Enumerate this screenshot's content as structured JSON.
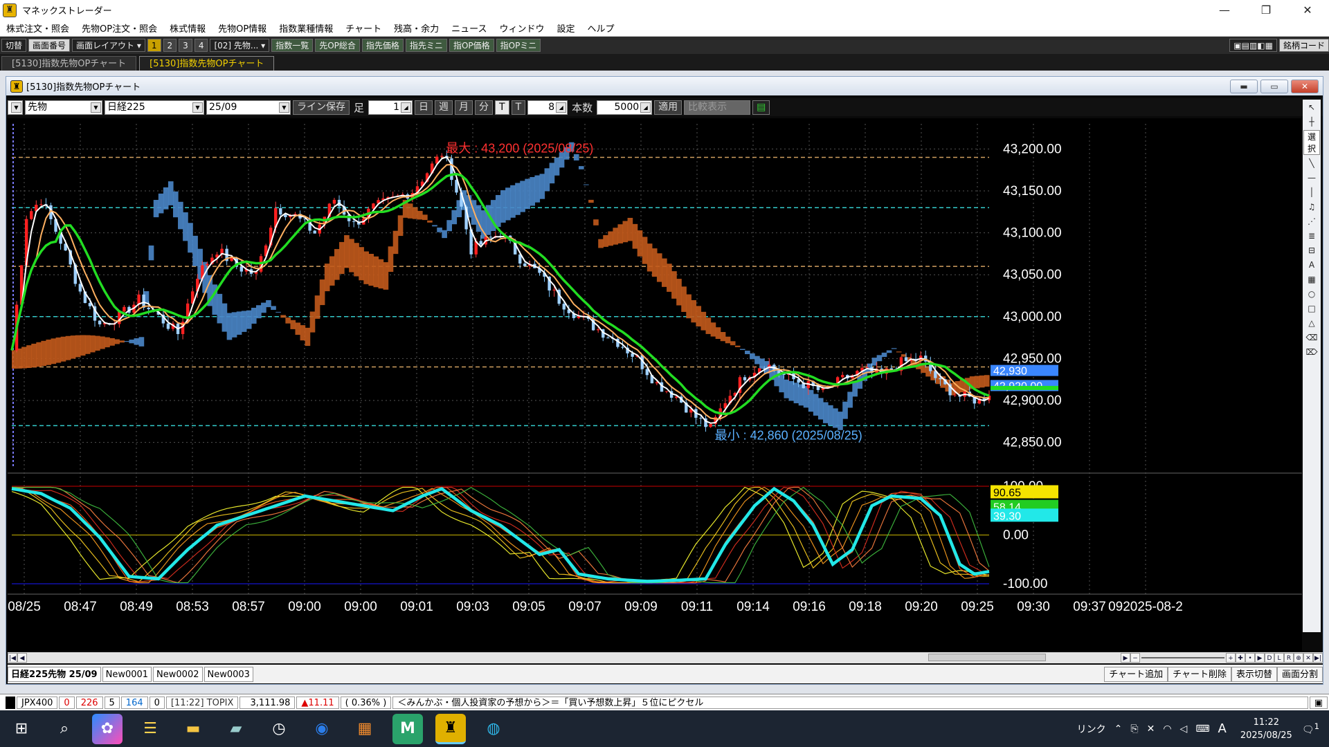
{
  "app": {
    "title": "マネックストレーダー"
  },
  "menu": [
    "株式注文・照会",
    "先物OP注文・照会",
    "株式情報",
    "先物OP情報",
    "指数業種情報",
    "チャート",
    "残高・余力",
    "ニュース",
    "ウィンドウ",
    "設定",
    "ヘルプ"
  ],
  "toolbar": {
    "switch": "切替",
    "screen_no": "画面番号",
    "layout": "画面レイアウト",
    "layouts": [
      "1",
      "2",
      "3",
      "4"
    ],
    "preset": "[02] 先物...",
    "buttons": [
      "指数一覧",
      "先OP総合",
      "指先価格",
      "指先ミニ",
      "指OP価格",
      "指OPミニ"
    ],
    "code_label": "銘柄コード"
  },
  "tabs": [
    "[5130]指数先物OPチャート",
    "[5130]指数先物OPチャート"
  ],
  "window": {
    "title": "[5130]指数先物OPチャート"
  },
  "controls": {
    "instrument": "先物",
    "index": "日経225",
    "contract": "25/09",
    "save_line": "ライン保存",
    "foot_label": "足",
    "foot_value": "1",
    "periods": [
      "日",
      "週",
      "月",
      "分",
      "T"
    ],
    "tick_label": "T",
    "tick_value": "8",
    "count_label": "本数",
    "count_value": "5000",
    "apply": "適用",
    "compare": "比較表示"
  },
  "chart_data": {
    "type": "candlestick",
    "series_name": "日経225先物 25/09",
    "annotations": {
      "max": "最大 : 43,200 (2025/08/25)",
      "min": "最小 : 42,860 (2025/08/25)"
    },
    "price_ylim": [
      42820,
      43230
    ],
    "price_ticks": [
      "43,200.00",
      "43,150.00",
      "43,100.00",
      "43,050.00",
      "43,000.00",
      "42,950.00",
      "42,900.00",
      "42,850.00"
    ],
    "price_badges": [
      {
        "label": "42,930",
        "color": "#3a86ff"
      },
      {
        "label": "42,920.00",
        "color": "#3a86ff"
      },
      {
        "label": "",
        "color": "#22dd22"
      }
    ],
    "osc_ylim": [
      -110,
      110
    ],
    "osc_ticks": [
      "100.00",
      "0.00",
      "-100.00"
    ],
    "osc_badges": [
      {
        "label": "90.65",
        "color": "#f5e400"
      },
      {
        "label": "58.14",
        "color": "#22cc22"
      },
      {
        "label": "39.30",
        "color": "#22e8e8"
      }
    ],
    "x_labels": [
      "08/25",
      "08:47",
      "08:49",
      "08:53",
      "08:57",
      "09:00",
      "09:00",
      "09:01",
      "09:03",
      "09:05",
      "09:07",
      "09:09",
      "09:11",
      "09:14",
      "09:16",
      "09:18",
      "09:20",
      "09:25",
      "09:30",
      "09:37",
      "092025-08-2"
    ],
    "close_path": [
      [
        0,
        42960
      ],
      [
        3,
        43120
      ],
      [
        6,
        43140
      ],
      [
        10,
        43090
      ],
      [
        14,
        43030
      ],
      [
        18,
        42990
      ],
      [
        22,
        43000
      ],
      [
        26,
        43020
      ],
      [
        30,
        43000
      ],
      [
        34,
        42980
      ],
      [
        38,
        43050
      ],
      [
        42,
        43080
      ],
      [
        46,
        43060
      ],
      [
        50,
        43050
      ],
      [
        54,
        43130
      ],
      [
        58,
        43120
      ],
      [
        62,
        43100
      ],
      [
        66,
        43140
      ],
      [
        70,
        43110
      ],
      [
        74,
        43130
      ],
      [
        78,
        43140
      ],
      [
        82,
        43150
      ],
      [
        86,
        43180
      ],
      [
        88,
        43195
      ],
      [
        90,
        43170
      ],
      [
        92,
        43130
      ],
      [
        94,
        43080
      ],
      [
        97,
        43090
      ],
      [
        100,
        43100
      ],
      [
        104,
        43070
      ],
      [
        108,
        43050
      ],
      [
        112,
        43020
      ],
      [
        116,
        43000
      ],
      [
        120,
        42985
      ],
      [
        124,
        42970
      ],
      [
        128,
        42950
      ],
      [
        132,
        42920
      ],
      [
        136,
        42905
      ],
      [
        140,
        42880
      ],
      [
        143,
        42866
      ],
      [
        146,
        42900
      ],
      [
        150,
        42930
      ],
      [
        154,
        42945
      ],
      [
        158,
        42930
      ],
      [
        162,
        42920
      ],
      [
        166,
        42910
      ],
      [
        170,
        42925
      ],
      [
        174,
        42935
      ],
      [
        178,
        42930
      ],
      [
        182,
        42945
      ],
      [
        186,
        42950
      ],
      [
        190,
        42920
      ],
      [
        194,
        42905
      ],
      [
        198,
        42900
      ],
      [
        200,
        42910
      ]
    ],
    "osc_path": [
      [
        0,
        95
      ],
      [
        6,
        85
      ],
      [
        12,
        55
      ],
      [
        18,
        -5
      ],
      [
        24,
        -85
      ],
      [
        30,
        -90
      ],
      [
        36,
        -30
      ],
      [
        42,
        20
      ],
      [
        48,
        40
      ],
      [
        54,
        60
      ],
      [
        60,
        80
      ],
      [
        66,
        70
      ],
      [
        72,
        60
      ],
      [
        78,
        50
      ],
      [
        84,
        80
      ],
      [
        88,
        95
      ],
      [
        94,
        50
      ],
      [
        100,
        20
      ],
      [
        104,
        -10
      ],
      [
        108,
        -40
      ],
      [
        112,
        -30
      ],
      [
        116,
        -80
      ],
      [
        122,
        -90
      ],
      [
        130,
        -95
      ],
      [
        136,
        -93
      ],
      [
        142,
        -90
      ],
      [
        146,
        -20
      ],
      [
        152,
        60
      ],
      [
        156,
        95
      ],
      [
        160,
        70
      ],
      [
        164,
        20
      ],
      [
        168,
        -60
      ],
      [
        172,
        -30
      ],
      [
        176,
        60
      ],
      [
        180,
        80
      ],
      [
        186,
        75
      ],
      [
        190,
        40
      ],
      [
        194,
        -60
      ],
      [
        197,
        -80
      ],
      [
        200,
        -75
      ]
    ]
  },
  "bottom": {
    "sheet_tabs": [
      "日経225先物 25/09",
      "New0001",
      "New0002",
      "New0003"
    ],
    "actions": [
      "チャート追加",
      "チャート削除",
      "表示切替",
      "画面分割"
    ]
  },
  "status": {
    "ticker": "JPX400",
    "vals": [
      "0",
      "226",
      "5",
      "164",
      "0"
    ],
    "time_index": "[11:22] TOPIX",
    "price": "3,111.98",
    "change": "▲11.11",
    "pct": "( 0.36% )",
    "news": "＜みんかぶ・個人投資家の予想から＞＝「買い予想数上昇」５位にピクセル"
  },
  "taskbar": {
    "tray_link": "リンク",
    "ime": "A",
    "time": "11:22",
    "date": "2025/08/25",
    "notif": "1"
  }
}
